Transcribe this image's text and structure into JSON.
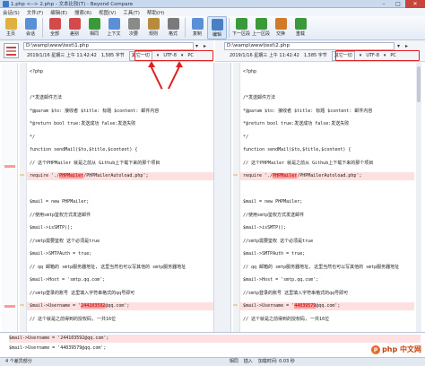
{
  "window": {
    "title": "1.php <--> 2.php - 文本比较(T) - Beyond Compare"
  },
  "menu": [
    "会话(S)",
    "文件(F)",
    "编辑(E)",
    "搜索(R)",
    "视图(V)",
    "工具(T)",
    "帮助(H)"
  ],
  "toolbar": [
    {
      "label": "主页",
      "icon": "home-icon",
      "color": "#e0b040"
    },
    {
      "label": "会话",
      "icon": "session-icon",
      "color": "#5b8fd6"
    },
    {
      "label": "全部",
      "icon": "all-icon",
      "color": "#d44a4a"
    },
    {
      "label": "差别",
      "icon": "diff-icon",
      "color": "#d44a4a"
    },
    {
      "label": "相同",
      "icon": "same-icon",
      "color": "#3a9a3a"
    },
    {
      "label": "上下文",
      "icon": "context-icon",
      "color": "#5b8fd6"
    },
    {
      "label": "次要",
      "icon": "minor-icon",
      "color": "#8a8a8a"
    },
    {
      "label": "规则",
      "icon": "rules-icon",
      "color": "#b88b3c"
    },
    {
      "label": "格式",
      "icon": "format-icon",
      "color": "#7a7a7a"
    },
    {
      "label": "复制",
      "icon": "copy-icon",
      "color": "#5b8fd6"
    },
    {
      "label": "编辑",
      "icon": "edit-icon",
      "color": "#4a7fc4"
    },
    {
      "label": "下一区段",
      "icon": "next-section-icon",
      "color": "#3a9a3a"
    },
    {
      "label": "上一区段",
      "icon": "prev-section-icon",
      "color": "#3a9a3a"
    },
    {
      "label": "交换",
      "icon": "swap-icon",
      "color": "#d07a2a"
    },
    {
      "label": "重载",
      "icon": "reload-icon",
      "color": "#3a9a3a"
    }
  ],
  "left": {
    "path": "D:\\wamp\\www\\test\\1.php",
    "date": "2019/1/16 星期三 上午 11:42:42",
    "size": "1,585 字节",
    "filter": "其它一切",
    "encoding": "UTF-8",
    "lineend": "PC"
  },
  "right": {
    "path": "D:\\wamp\\www\\test\\2.php",
    "date": "2019/1/16 星期三 上午 11:42:42",
    "size": "1,585 字节",
    "filter": "其它一切",
    "encoding": "UTF-8",
    "lineend": "PC"
  },
  "code_left": [
    "<?php",
    "",
    "/*发送邮件方法",
    " *@param $to: 接收者 $title: 标题 $content: 邮件内容",
    " *@return bool true:发送成功 false:发送失败",
    " */",
    "function sendMail($to,$title,$content) {",
    "    // 这个PHPMailer 就是之前从 Github上下载下来的那个项目",
    "    require './PHPMailer/PHPMailerAutoload.php';",
    "",
    "    $mail = new PHPMailer;",
    "    //使用smtp鉴权方式发送邮件",
    "    $mail->isSMTP();",
    "    //smtp需要鉴权 这个必须是true",
    "    $mail->SMTPAuth = true;",
    "    // qq 邮箱的 smtp服务器地址, 这里当然也可以写其他的 smtp服务器地址",
    "    $mail->Host = 'smtp.qq.com';",
    "    //smtp登录的账号 这里填入字符串格式的qq号即可",
    "    $mail->Username = '244103592@qq.com';",
    "    // 这个就是之前得到的授权码, 一共16位"
  ],
  "code_right": [
    "<?php",
    "",
    "/*发送邮件方法",
    " *@param $to: 接收者 $title: 标题 $content: 邮件内容",
    " *@return bool true:发送成功 false:发送失败",
    " */",
    "function sendMail($to,$title,$content) {",
    "    // 这个PHPMailer 就是之前从 Github上下载下来的那个项目",
    "    require './PHPMailer/PHPMailerAutoload.php';",
    "",
    "    $mail = new PHPMailer;",
    "    //使用smtp鉴权方式发送邮件",
    "    $mail->isSMTP();",
    "    //smtp需要鉴权 这个必须是true",
    "    $mail->SMTPAuth = true;",
    "    // qq 邮箱的 smtp服务器地址, 这里当然也可以写其他的 smtp服务器地址",
    "    $mail->Host = 'smtp.qq.com';",
    "    //smtp登录的账号 这里填入字符串格式的qq号即可",
    "    $mail->Username = '44039579@qq.com';",
    "    // 这个就是之前得到的授权码, 一共16位"
  ],
  "detail": {
    "left": "$mail->Username = '244103592@qq.com';",
    "right": "$mail->Username = '44039579@qq.com';"
  },
  "status": {
    "diffs": "4 个差异部分",
    "same": "相同",
    "insert": "插入",
    "loadtime": "加载时间: 0.03 秒"
  },
  "watermark": "php 中文网",
  "colors": {
    "diff_bg": "#ffe0e0",
    "highlight": "#ff9a9a",
    "annotation": "#e02020"
  }
}
